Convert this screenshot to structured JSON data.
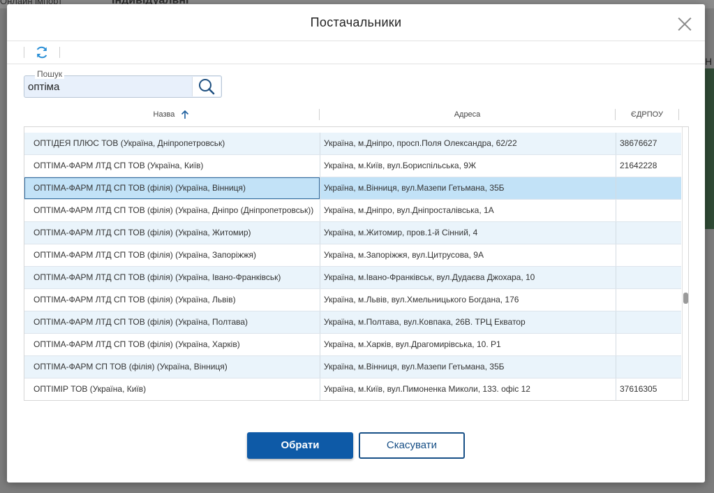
{
  "background": {
    "text_left": "Онлайн імпорт",
    "text_mid": "Індивідуальні",
    "text_right": "Н"
  },
  "dialog": {
    "title": "Постачальники",
    "search": {
      "legend": "Пошук",
      "value": "оптіма"
    },
    "columns": {
      "name": "Назва",
      "address": "Адреса",
      "edrpou": "ЄДРПОУ"
    },
    "rows": [
      {
        "name": "ОПТІДЕЯ ПЛЮС ТОВ (Україна, Дніпропетровськ)",
        "address": "Україна, м.Дніпро, просп.Поля Олександра, 62/22",
        "edrpou": "38676627"
      },
      {
        "name": "ОПТІМА-ФАРМ ЛТД СП ТОВ (Україна, Київ)",
        "address": "Україна, м.Київ, вул.Бориспільська, 9Ж",
        "edrpou": "21642228"
      },
      {
        "name": "ОПТІМА-ФАРМ ЛТД СП ТОВ (філія) (Україна, Вінниця)",
        "address": "Україна, м.Вінниця, вул.Мазепи Гетьмана, 35Б",
        "edrpou": ""
      },
      {
        "name": "ОПТІМА-ФАРМ ЛТД СП ТОВ (філія) (Україна, Дніпро (Дніпропетровськ))",
        "address": "Україна, м.Дніпро, вул.Дніпросталівська, 1А",
        "edrpou": ""
      },
      {
        "name": "ОПТІМА-ФАРМ ЛТД СП ТОВ (філія) (Україна, Житомир)",
        "address": "Україна, м.Житомир, пров.1-й Сінний, 4",
        "edrpou": ""
      },
      {
        "name": "ОПТІМА-ФАРМ ЛТД СП ТОВ (філія) (Україна, Запоріжжя)",
        "address": "Україна, м.Запоріжжя, вул.Цитрусова, 9А",
        "edrpou": ""
      },
      {
        "name": "ОПТІМА-ФАРМ ЛТД СП ТОВ (філія) (Україна, Івано-Франківськ)",
        "address": "Україна, м.Івано-Франківськ, вул.Дудаєва Джохара, 10",
        "edrpou": ""
      },
      {
        "name": "ОПТІМА-ФАРМ ЛТД СП ТОВ (філія) (Україна, Львів)",
        "address": "Україна, м.Львів, вул.Хмельницького Богдана, 176",
        "edrpou": ""
      },
      {
        "name": "ОПТІМА-ФАРМ ЛТД СП ТОВ (філія) (Україна, Полтава)",
        "address": "Україна, м.Полтава, вул.Ковпака, 26В. ТРЦ Екватор",
        "edrpou": ""
      },
      {
        "name": "ОПТІМА-ФАРМ ЛТД СП ТОВ (філія) (Україна, Харків)",
        "address": "Україна, м.Харків, вул.Драгомирівська, 10. Р1",
        "edrpou": ""
      },
      {
        "name": "ОПТІМА-ФАРМ СП ТОВ (філія) (Україна, Вінниця)",
        "address": "Україна, м.Вінниця, вул.Мазепи Гетьмана, 35Б",
        "edrpou": ""
      },
      {
        "name": "ОПТІМІР ТОВ (Україна, Київ)",
        "address": "Україна, м.Київ, вул.Пимоненка Миколи, 133. офіс 12",
        "edrpou": "37616305"
      }
    ],
    "selected_row_index": 2,
    "buttons": {
      "ok": "Обрати",
      "cancel": "Скасувати"
    },
    "colors": {
      "primary": "#0e5aa7",
      "selected_row": "#c2e2f7",
      "alt_row": "#eaf4fb"
    },
    "icons": {
      "refresh": "refresh-icon",
      "search": "search-icon",
      "close": "close-icon",
      "sort": "arrow-up-icon"
    }
  }
}
